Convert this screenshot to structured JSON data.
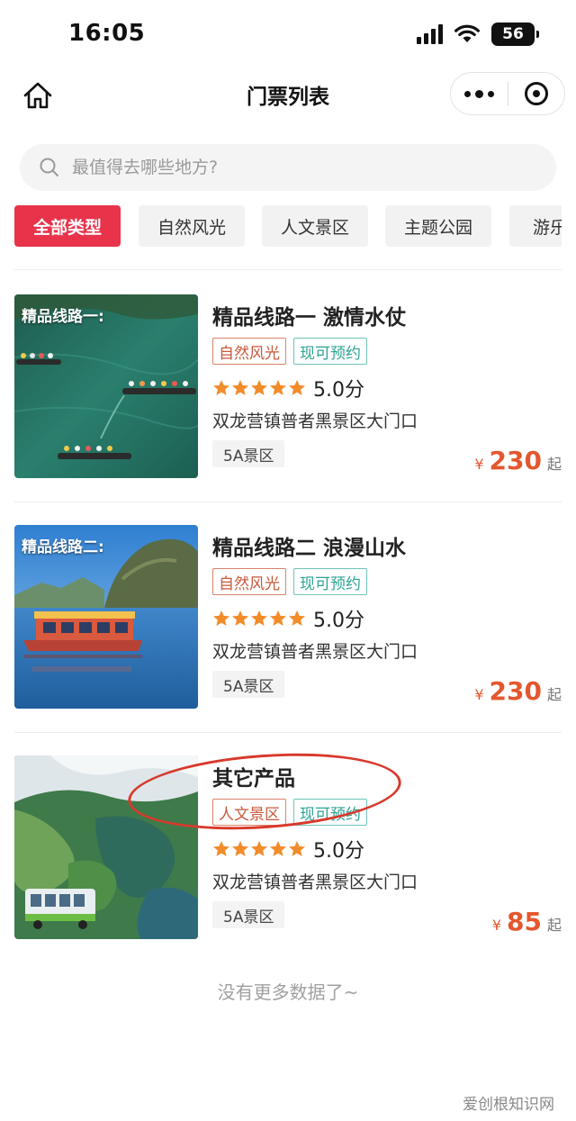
{
  "status_bar": {
    "time": "16:05",
    "battery": "56",
    "icons": [
      "signal-icon",
      "wifi-icon",
      "battery-icon"
    ]
  },
  "navbar": {
    "title": "门票列表",
    "home_icon": "home-icon",
    "more_icon": "more-icon",
    "close_icon": "close-target-icon"
  },
  "search": {
    "placeholder": "最值得去哪些地方?",
    "value": ""
  },
  "tabs": [
    {
      "label": "全部类型",
      "active": true
    },
    {
      "label": "自然风光",
      "active": false
    },
    {
      "label": "人文景区",
      "active": false
    },
    {
      "label": "主题公园",
      "active": false
    },
    {
      "label": "游乐",
      "active": false
    }
  ],
  "items": [
    {
      "thumb_label": "精品线路一:",
      "name": "精品线路一 激情水仗",
      "tags": [
        "自然风光",
        "现可预约"
      ],
      "stars": 5,
      "score": "5.0分",
      "address": "双龙营镇普者黑景区大门口",
      "level": "5A景区",
      "currency": "¥",
      "price": "230",
      "price_suffix": "起"
    },
    {
      "thumb_label": "精品线路二:",
      "name": "精品线路二 浪漫山水",
      "tags": [
        "自然风光",
        "现可预约"
      ],
      "stars": 5,
      "score": "5.0分",
      "address": "双龙营镇普者黑景区大门口",
      "level": "5A景区",
      "currency": "¥",
      "price": "230",
      "price_suffix": "起"
    },
    {
      "thumb_label": "",
      "name": "其它产品",
      "tags": [
        "人文景区",
        "现可预约"
      ],
      "stars": 5,
      "score": "5.0分",
      "address": "双龙营镇普者黑景区大门口",
      "level": "5A景区",
      "currency": "¥",
      "price": "85",
      "price_suffix": "起"
    }
  ],
  "footer": {
    "end_text": "没有更多数据了~",
    "watermark": "爱创根知识网"
  },
  "colors": {
    "accent": "#e8334b",
    "price": "#e4572e",
    "star": "#f28c2a",
    "tag_nature": "#c9583b",
    "tag_book": "#2ea394",
    "annotation": "#d8392c"
  }
}
